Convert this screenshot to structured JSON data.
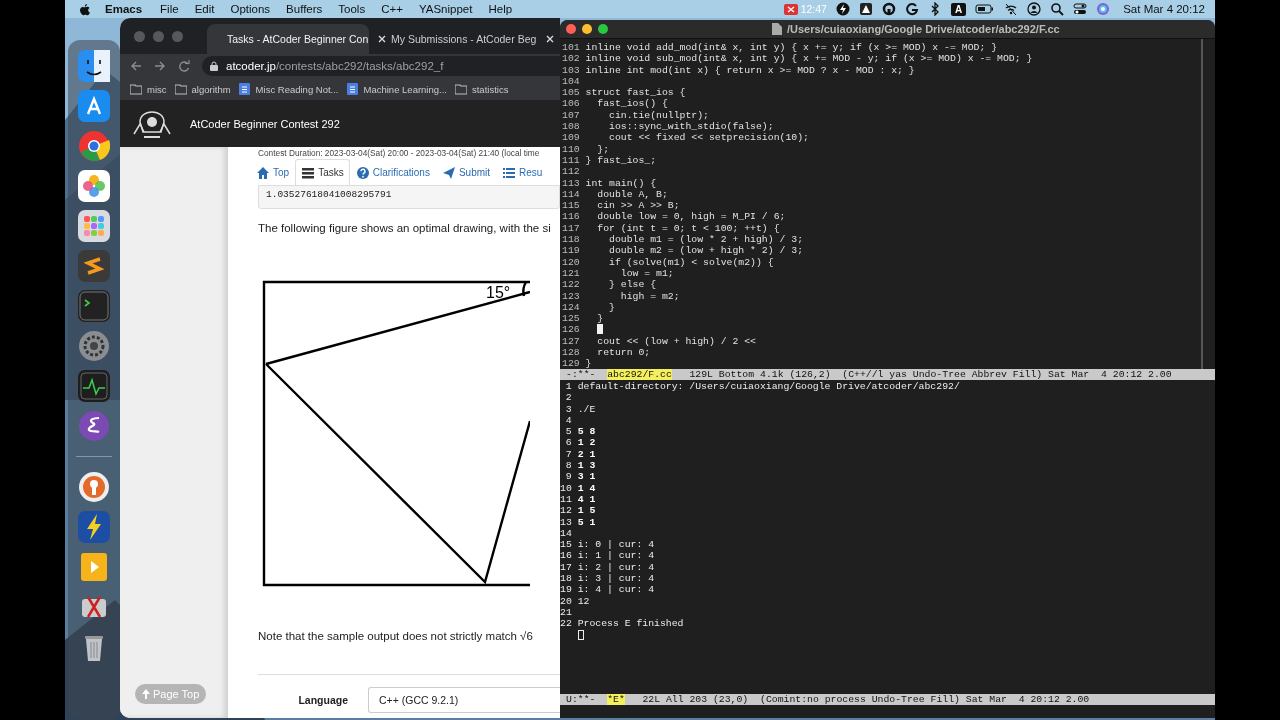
{
  "menubar": {
    "app": "Emacs",
    "menus": [
      "File",
      "Edit",
      "Options",
      "Buffers",
      "Tools",
      "C++",
      "YASnippet",
      "Help"
    ],
    "recording_time": "12:47",
    "input_source": "A",
    "clock": "Sat Mar 4  20:12"
  },
  "browser": {
    "tabs": [
      {
        "label": "Tasks - AtCoder Beginner Con",
        "selected": true
      },
      {
        "label": "My Submissions - AtCoder Beg",
        "selected": false
      }
    ],
    "url_host": "atcoder.jp",
    "url_path": "/contests/abc292/tasks/abc292_f",
    "bookmarks": [
      {
        "label": "misc",
        "kind": "folder"
      },
      {
        "label": "algorithm",
        "kind": "folder"
      },
      {
        "label": "Misc Reading Not...",
        "kind": "doc"
      },
      {
        "label": "Machine Learning...",
        "kind": "doc"
      },
      {
        "label": "statistics",
        "kind": "folder"
      }
    ],
    "site_title": "AtCoder Beginner Contest 292",
    "duration": "Contest Duration: 2023-03-04(Sat) 20:00 - 2023-03-04(Sat) 21:40 (local time",
    "nav": [
      {
        "label": "Top",
        "selected": false
      },
      {
        "label": "Tasks",
        "selected": true
      },
      {
        "label": "Clarifications",
        "selected": false
      },
      {
        "label": "Submit",
        "selected": false
      },
      {
        "label": "Resu",
        "selected": false
      }
    ],
    "sample_output": "1.03527618041008295791",
    "paragraph": "The following figure shows an optimal drawing, with the si",
    "figure": {
      "angle_label": "15°"
    },
    "note": "Note that the sample output does not strictly match √6",
    "language_label": "Language",
    "language_value": "C++ (GCC 9.2.1)",
    "page_top": "Page Top"
  },
  "emacs": {
    "title": "/Users/cuiaoxiang/Google Drive/atcoder/abc292/F.cc",
    "code": [
      {
        "n": "101",
        "text": "inline void add_mod(int& x, int y) { x += y; if (x >= MOD) x -= MOD; }",
        "cursor": false
      },
      {
        "n": "102",
        "text": "inline void sub_mod(int& x, int y) { x += MOD - y; if (x >= MOD) x -= MOD; }",
        "cursor": false
      },
      {
        "n": "103",
        "text": "inline int mod(int x) { return x >= MOD ? x - MOD : x; }",
        "cursor": false
      },
      {
        "n": "104",
        "cursor": false
      },
      {
        "n": "105",
        "text": "struct fast_ios {",
        "cursor": false
      },
      {
        "n": "106",
        "text": "  fast_ios() {",
        "cursor": false
      },
      {
        "n": "107",
        "text": "    cin.tie(nullptr);",
        "cursor": false
      },
      {
        "n": "108",
        "text": "    ios::sync_with_stdio(false);",
        "cursor": false
      },
      {
        "n": "109",
        "text": "    cout << fixed << setprecision(10);",
        "cursor": false
      },
      {
        "n": "110",
        "text": "  };",
        "cursor": false
      },
      {
        "n": "111",
        "text": "} fast_ios_;",
        "cursor": false
      },
      {
        "n": "112",
        "cursor": false
      },
      {
        "n": "113",
        "text": "int main() {",
        "cursor": false
      },
      {
        "n": "114",
        "text": "  double A, B;",
        "cursor": false
      },
      {
        "n": "115",
        "text": "  cin >> A >> B;",
        "cursor": false
      },
      {
        "n": "116",
        "text": "  double low = 0, high = M_PI / 6;",
        "cursor": false
      },
      {
        "n": "117",
        "text": "  for (int t = 0; t < 100; ++t) {",
        "cursor": false
      },
      {
        "n": "118",
        "text": "    double m1 = (low * 2 + high) / 3;",
        "cursor": false
      },
      {
        "n": "119",
        "text": "    double m2 = (low + high * 2) / 3;",
        "cursor": false
      },
      {
        "n": "120",
        "text": "    if (solve(m1) < solve(m2)) {",
        "cursor": false
      },
      {
        "n": "121",
        "text": "      low = m1;",
        "cursor": false
      },
      {
        "n": "122",
        "text": "    } else {",
        "cursor": false
      },
      {
        "n": "123",
        "text": "      high = m2;",
        "cursor": false
      },
      {
        "n": "124",
        "text": "    }",
        "cursor": false
      },
      {
        "n": "125",
        "text": "  }",
        "cursor": false
      },
      {
        "n": "126",
        "cursor": true
      },
      {
        "n": "127",
        "text": "  cout << (low + high) / 2 <<",
        "cursor": false
      },
      {
        "n": "128",
        "text": "  return 0;",
        "cursor": false
      },
      {
        "n": "129",
        "text": "}",
        "cursor": false
      }
    ],
    "mode_line": {
      "flags": "-:**-",
      "buffer": "abc292/F.cc",
      "info": "129L Bottom 4.1k (126,2)  (C++//l yas Undo-Tree Abbrev Fill) Sat Mar  4 20:12 2.00"
    },
    "output": [
      {
        "n": "1",
        "text": "default-directory: /Users/cuiaoxiang/Google Drive/atcoder/abc292/",
        "kind": "plain"
      },
      {
        "n": "2"
      },
      {
        "n": "3",
        "text": "./E",
        "kind": "plain"
      },
      {
        "n": "4"
      },
      {
        "n": "5",
        "text": "5 8",
        "kind": "input"
      },
      {
        "n": "6",
        "text": "1 2",
        "kind": "input"
      },
      {
        "n": "7",
        "text": "2 1",
        "kind": "input"
      },
      {
        "n": "8",
        "text": "1 3",
        "kind": "input"
      },
      {
        "n": "9",
        "text": "3 1",
        "kind": "input"
      },
      {
        "n": "10",
        "text": "1 4",
        "kind": "input"
      },
      {
        "n": "11",
        "text": "4 1",
        "kind": "input"
      },
      {
        "n": "12",
        "text": "1 5",
        "kind": "input"
      },
      {
        "n": "13",
        "text": "5 1",
        "kind": "input"
      },
      {
        "n": "14"
      },
      {
        "n": "15",
        "text": "i: 0 | cur: 4",
        "kind": "plain"
      },
      {
        "n": "16",
        "text": "i: 1 | cur: 4",
        "kind": "plain"
      },
      {
        "n": "17",
        "text": "i: 2 | cur: 4",
        "kind": "plain"
      },
      {
        "n": "18",
        "text": "i: 3 | cur: 4",
        "kind": "plain"
      },
      {
        "n": "19",
        "text": "i: 4 | cur: 4",
        "kind": "plain"
      },
      {
        "n": "20",
        "text": "12",
        "kind": "plain"
      },
      {
        "n": "21"
      },
      {
        "n": "22",
        "text": "Process E finished",
        "kind": "plain"
      }
    ],
    "output_cursor": true,
    "mode_line_2": {
      "flags": "U:**-",
      "buffer": "*E*",
      "info": "22L All 203 (23,0)  (Comint:no process Undo-Tree Fill) Sat Mar  4 20:12 2.00"
    }
  }
}
